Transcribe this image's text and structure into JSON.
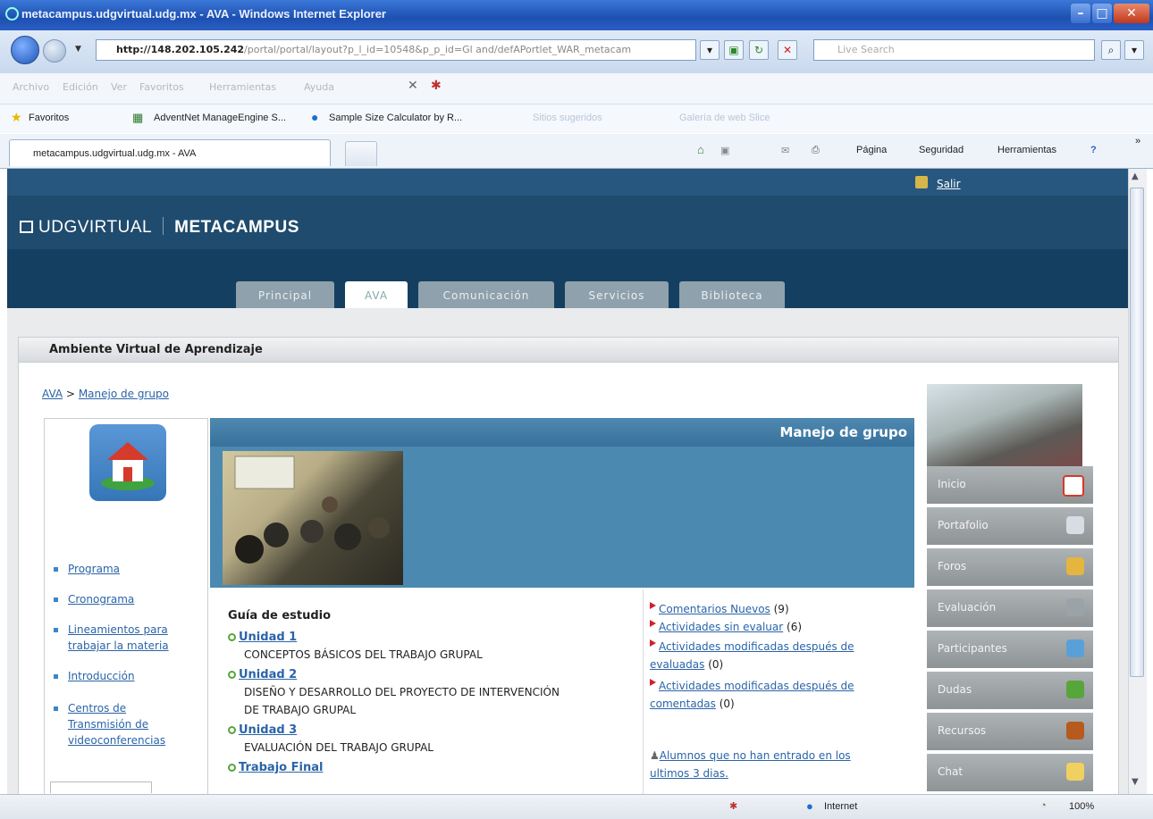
{
  "window": {
    "title": "metacampus.udgvirtual.udg.mx - AVA - Windows Internet Explorer"
  },
  "address": {
    "host": "http://148.202.105.242",
    "path": "/portal/portal/layout?p_l_id=10548&p_p_id=Gl and/defAPortlet_WAR_metacam"
  },
  "search": {
    "placeholder": "Live Search"
  },
  "menu": {
    "items": [
      "Archivo",
      "Edición",
      "Ver",
      "Favoritos",
      "Herramientas",
      "Ayuda"
    ]
  },
  "favorites": {
    "label": "Favoritos",
    "items": [
      "AdventNet ManageEngine S...",
      "Sample Size Calculator by R...",
      "Sitios sugeridos",
      "Galería de web Slice"
    ]
  },
  "browser_tab": {
    "label": "metacampus.udgvirtual.udg.mx - AVA"
  },
  "commandbar": {
    "pagina": "Página",
    "seguridad": "Seguridad",
    "herramientas": "Herramientas"
  },
  "site": {
    "salir": "Salir",
    "logo_left": "UDGVIRTUAL",
    "logo_right": "METACAMPUS",
    "tabs": [
      {
        "label": "Principal",
        "active": false
      },
      {
        "label": "AVA",
        "active": true
      },
      {
        "label": "Comunicación",
        "active": false
      },
      {
        "label": "Servicios",
        "active": false
      },
      {
        "label": "Biblioteca",
        "active": false
      }
    ]
  },
  "panel": {
    "title": "Ambiente Virtual de Aprendizaje"
  },
  "breadcrumb": {
    "root": "AVA",
    "sep": ">",
    "current": "Manejo de grupo"
  },
  "leftnav": {
    "items": [
      "Programa",
      "Cronograma",
      "Lineamientos para",
      "trabajar la materia",
      "Introducción",
      "Centros de",
      "Transmisión de",
      "videoconferencias"
    ]
  },
  "main": {
    "title": "Manejo de grupo"
  },
  "guide": {
    "heading": "Guía de estudio",
    "units": [
      {
        "name": "Unidad 1",
        "desc": [
          "CONCEPTOS BÁSICOS DEL TRABAJO GRUPAL"
        ]
      },
      {
        "name": "Unidad 2",
        "desc": [
          "DISEÑO Y DESARROLLO DEL PROYECTO DE INTERVENCIÓN",
          "DE TRABAJO GRUPAL"
        ]
      },
      {
        "name": "Unidad 3",
        "desc": [
          "EVALUACIÓN DEL TRABAJO GRUPAL"
        ]
      },
      {
        "name": "Trabajo Final",
        "desc": []
      }
    ]
  },
  "notes": {
    "comentarios": "Comentarios Nuevos",
    "comentarios_count": "(9)",
    "sin_evaluar": "Actividades sin evaluar",
    "sin_evaluar_count": "(6)",
    "mod_eval_1": "Actividades modificadas después de",
    "mod_eval_2": "evaluadas",
    "mod_eval_count": "(0)",
    "mod_com_1": "Actividades modificadas después de",
    "mod_com_2": "comentadas",
    "mod_com_count": "(0)",
    "alumnos_1": "Alumnos que no han entrado en los",
    "alumnos_2": "ultimos 3 dias."
  },
  "sidemenu": {
    "items": [
      "Inicio",
      "Portafolio",
      "Foros",
      "Evaluación",
      "Participantes",
      "Dudas",
      "Recursos",
      "Chat"
    ]
  },
  "status": {
    "zone": "Internet",
    "zoom": "100%"
  },
  "colors": {
    "site_header": "#1f4b6e",
    "band": "#4c89b0",
    "link": "#2a64a8",
    "flag": "#d0202a"
  }
}
